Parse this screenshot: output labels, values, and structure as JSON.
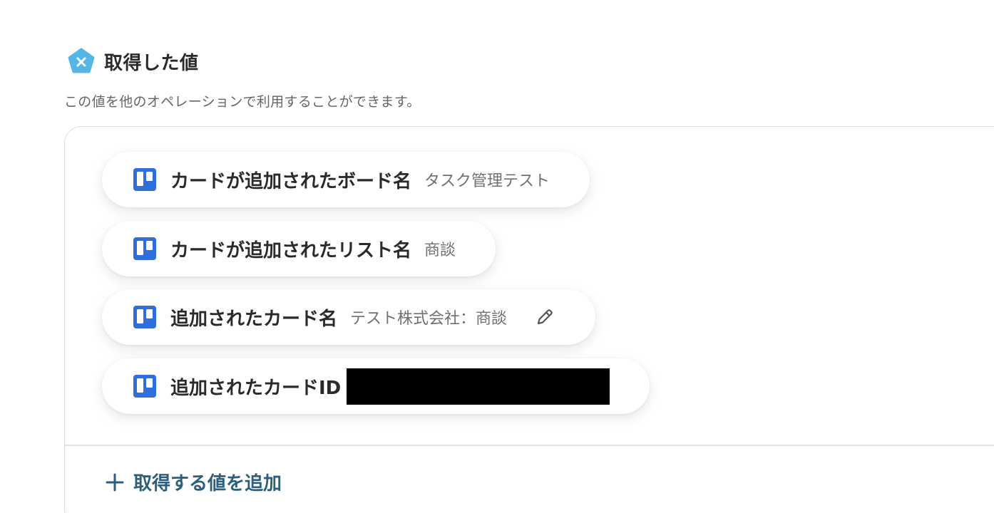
{
  "header": {
    "icon": "pentagon-x-icon",
    "title": "取得した値",
    "description": "この値を他のオペレーションで利用することができます。"
  },
  "fields": [
    {
      "icon": "trello-icon",
      "label": "カードが追加されたボード名",
      "value": "タスク管理テスト",
      "editable": false,
      "redacted": false
    },
    {
      "icon": "trello-icon",
      "label": "カードが追加されたリスト名",
      "value": "商談",
      "editable": false,
      "redacted": false
    },
    {
      "icon": "trello-icon",
      "label": "追加されたカード名",
      "value": "テスト株式会社：商談",
      "editable": true,
      "edit_icon": "pencil-icon",
      "redacted": false
    },
    {
      "icon": "trello-icon",
      "label": "追加されたカードID",
      "value": "",
      "editable": false,
      "redacted": true
    }
  ],
  "add_button": {
    "icon": "plus-icon",
    "label": "取得する値を追加"
  },
  "colors": {
    "accent_icon": "#4fb3e8",
    "trello_blue": "#2f6fdc",
    "add_button_text": "#2e5f7a"
  }
}
